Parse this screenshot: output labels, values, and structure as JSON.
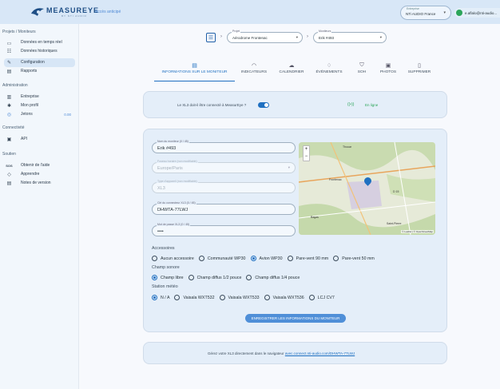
{
  "header": {
    "brand": "MEASUREYE",
    "brand_sub": "BY NTI AUDIO",
    "early_access": "Accès anticipé",
    "enterprise_label": "Entreprise",
    "enterprise_value": "NTi AUDIO France",
    "user": "e.aflalo@nti-audio..."
  },
  "sidebar": {
    "sections": [
      "Projets / Moniteurs",
      "Administration",
      "Connectivité",
      "Soutien"
    ],
    "items": [
      {
        "icon": "realtime-icon",
        "label": "Données en temps réel"
      },
      {
        "icon": "history-icon",
        "label": "Données historiques"
      },
      {
        "icon": "pen-icon",
        "label": "Configuration"
      },
      {
        "icon": "report-icon",
        "label": "Rapports"
      },
      {
        "icon": "building-icon",
        "label": "Entreprise"
      },
      {
        "icon": "profile-icon",
        "label": "Mon profil"
      },
      {
        "icon": "coin-icon",
        "label": "Jetons",
        "badge": "0.00"
      },
      {
        "icon": "api-icon",
        "label": "API"
      },
      {
        "icon": "sos-icon",
        "label": "Obtenir de l'aide"
      },
      {
        "icon": "learn-icon",
        "label": "Apprendre"
      },
      {
        "icon": "notes-icon",
        "label": "Notes de version"
      }
    ]
  },
  "breadcrumb": {
    "project_label": "Projet",
    "project_value": "Aérodrome Frontenac",
    "monitor_label": "Moniteurs",
    "monitor_value": "Erik #493"
  },
  "tabs": [
    {
      "icon": "info-icon",
      "label": "INFORMATIONS SUR LE MONITEUR"
    },
    {
      "icon": "wifi-icon",
      "label": "INDICATEURS"
    },
    {
      "icon": "cloud-icon",
      "label": "CALENDRIER"
    },
    {
      "icon": "bell-icon",
      "label": "ÉVÉNEMENTS"
    },
    {
      "icon": "shield-icon",
      "label": "SOH"
    },
    {
      "icon": "photos-icon",
      "label": "PHOTOS"
    },
    {
      "icon": "trash-icon",
      "label": "SUPPRIMER"
    }
  ],
  "connection": {
    "question": "Le XL3 doit-il être connecté à MeasurEye ?",
    "status": "En ligne",
    "enabled": true
  },
  "form": {
    "name_label": "Nom du moniteur (0 / 45)",
    "name_value": "Erik #493",
    "tz_label": "Fuseau horaire (non modifiable)",
    "tz_value": "Europe/Paris",
    "type_label": "Type d'appareil (non modifiable)",
    "type_value": "XL3",
    "key_label": "Clé du connecteur XL3 (0 / 45)",
    "key_value": "DHWTA-77LWJ",
    "pwd_label": "Mot de passe XL3 (0 / 45)",
    "pwd_value": "••••"
  },
  "map": {
    "attribution": "© Leaflet | © OpenStreetMap",
    "labels": [
      "Thouar",
      "Frontenac",
      "Bagas",
      "Saint-Pierre",
      "D 15"
    ]
  },
  "accessories": {
    "title": "Accessoires",
    "options": [
      "Aucun accessoire",
      "Communauté WP30",
      "Avion WP30",
      "Pare-vent 90 mm",
      "Pare-vent 50 mm"
    ],
    "selected": "Avion WP30"
  },
  "sound_field": {
    "title": "Champ sonore",
    "options": [
      "Champ libre",
      "Champ diffus 1/2 pouce",
      "Champ diffus 1/4 pouce"
    ],
    "selected": "Champ libre"
  },
  "weather": {
    "title": "Station météo",
    "options": [
      "N / A",
      "Vaisala WXT532",
      "Vaisala WXT533",
      "Vaisala WXT536",
      "LCJ CV7"
    ],
    "selected": "N / A"
  },
  "save_button": "ENREGISTRER LES INFORMATIONS DU MONITEUR",
  "footer": {
    "text": "Gérez votre XL3 directement dans le navigateur",
    "link": "avec.connect.nti-audio.com/DHWTA-77LWJ"
  },
  "colors": {
    "accent": "#1f70c1",
    "online": "#2ca55a"
  }
}
